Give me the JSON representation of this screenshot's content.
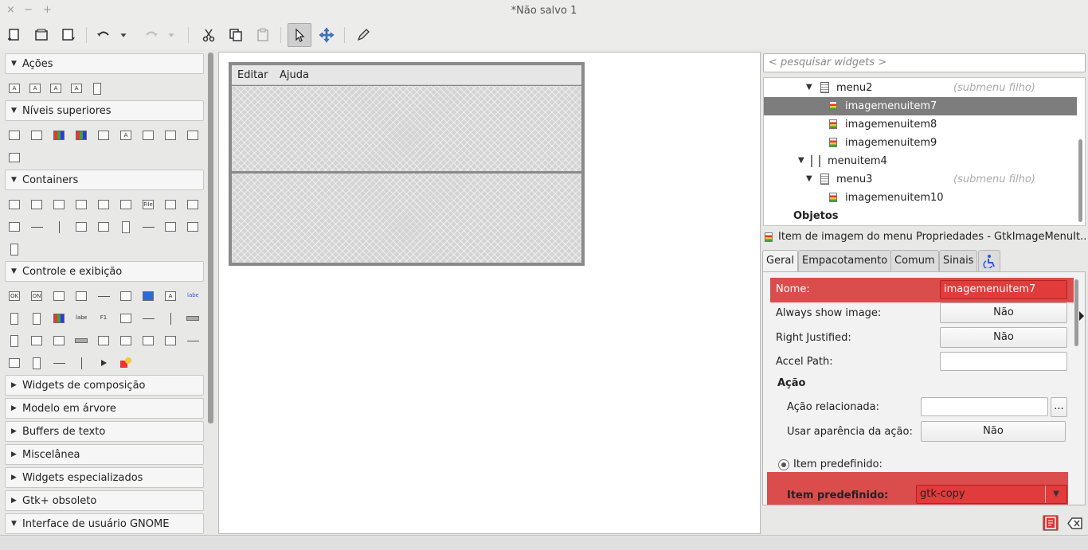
{
  "window": {
    "title": "*Não salvo 1",
    "close": "×",
    "minimize": "−",
    "maximize": "+"
  },
  "palette": {
    "categories": [
      {
        "label": "Ações",
        "expanded": "▼"
      },
      {
        "label": "Níveis superiores",
        "expanded": "▼"
      },
      {
        "label": "Containers",
        "expanded": "▼"
      },
      {
        "label": "Controle e exibição",
        "expanded": "▼"
      },
      {
        "label": "Widgets de composição",
        "expanded": "▶"
      },
      {
        "label": "Modelo em árvore",
        "expanded": "▶"
      },
      {
        "label": "Buffers de texto",
        "expanded": "▶"
      },
      {
        "label": "Miscelânea",
        "expanded": "▶"
      },
      {
        "label": "Widgets especializados",
        "expanded": "▶"
      },
      {
        "label": "Gtk+ obsoleto",
        "expanded": "▶"
      },
      {
        "label": "Interface de usuário GNOME",
        "expanded": "▼"
      }
    ],
    "icon_text": {
      "file": "File",
      "ok": "OK",
      "on": "ON",
      "label": "label",
      "label_blue": "label",
      "f1": "F1",
      "a": "A"
    }
  },
  "canvas": {
    "menu": [
      "Editar",
      "Ajuda"
    ]
  },
  "inspector": {
    "search_placeholder": "< pesquisar widgets >",
    "tree": [
      {
        "label": "menu2",
        "sub": "(submenu filho)"
      },
      {
        "label": "imagemenuitem7"
      },
      {
        "label": "imagemenuitem8"
      },
      {
        "label": "imagemenuitem9"
      },
      {
        "label": "menuitem4"
      },
      {
        "label": "menu3",
        "sub": "(submenu filho)"
      },
      {
        "label": "imagemenuitem10"
      },
      {
        "label": "Objetos"
      }
    ],
    "expander": "▼"
  },
  "properties": {
    "header": "Item de imagem do menu Propriedades - GtkImageMenuIt...",
    "tabs": [
      "Geral",
      "Empacotamento",
      "Comum",
      "Sinais"
    ],
    "nome_label": "Nome:",
    "nome_value": "imagemenuitem7",
    "always_show_label": "Always show image:",
    "always_show_value": "Não",
    "right_justified_label": "Right Justified:",
    "right_justified_value": "Não",
    "accel_label": "Accel Path:",
    "accel_value": "",
    "acao_heading": "Ação",
    "acao_rel_label": "Ação relacionada:",
    "acao_rel_value": "",
    "acao_rel_btn": "...",
    "usar_label": "Usar aparência da ação:",
    "usar_value": "Não",
    "item_pre_radio_label": "Item predefinido:",
    "item_pre_label": "Item predefinido:",
    "item_pre_value": "gtk-copy",
    "combo_arrow": "▼"
  },
  "colors": {
    "highlight": "#d62828",
    "selection": "#7d7d7d"
  }
}
